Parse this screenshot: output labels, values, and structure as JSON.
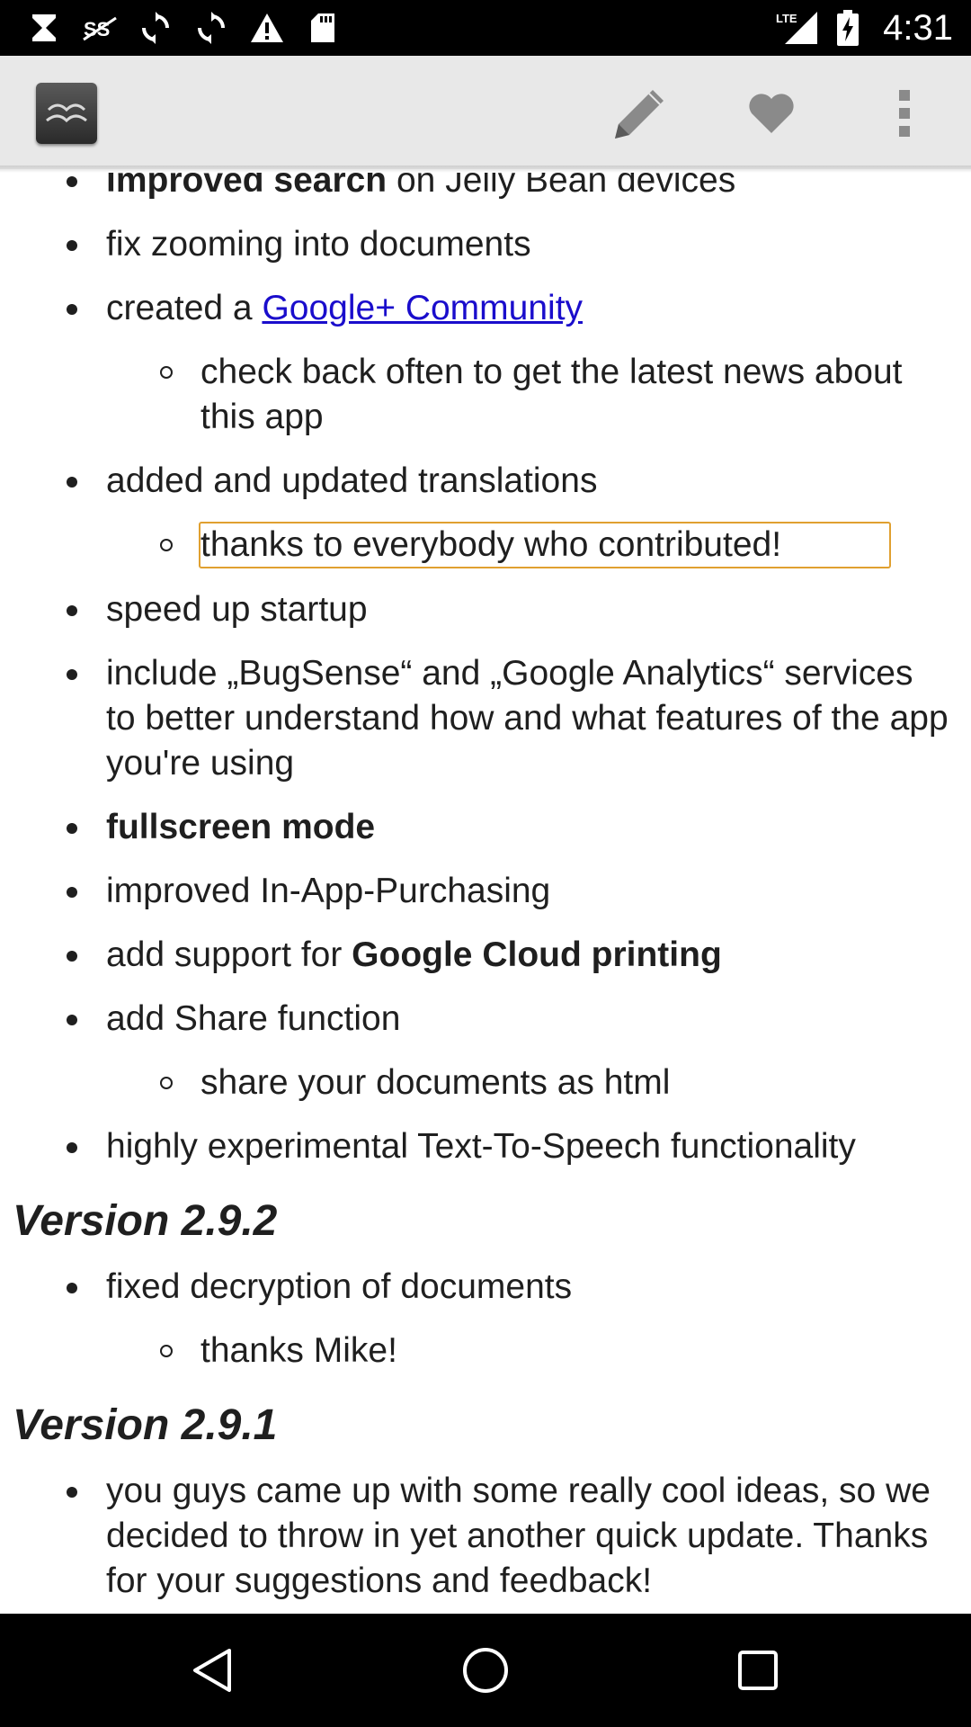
{
  "status_bar": {
    "time": "4:31",
    "network": "LTE",
    "left_icons": [
      "hourglass-icon",
      "sync-disabled-icon",
      "sync-icon",
      "sync-icon",
      "warning-icon",
      "sd-card-icon"
    ],
    "right_icons": [
      "signal-icon",
      "battery-charging-icon"
    ]
  },
  "action_bar": {
    "app_icon": "app-logo-icon",
    "actions": [
      "pencil-icon",
      "heart-icon",
      "overflow-menu-icon"
    ],
    "colors": {
      "background": "#e8e8e8"
    }
  },
  "content": {
    "list_a": [
      {
        "bold": "improved search",
        "text": " on Jelly Bean devices"
      },
      {
        "text": "fix zooming into documents"
      },
      {
        "text": "created a ",
        "link": "Google+ Community",
        "sub": [
          "check back often to get the latest news about this app"
        ]
      },
      {
        "text": "added and updated translations",
        "sub": [
          "thanks to everybody who contributed!"
        ]
      },
      {
        "text": "speed up startup"
      },
      {
        "text": "include „BugSense“ and „Google Analytics“ services to better understand how and what features of the app you're using"
      },
      {
        "bold": "fullscreen mode"
      },
      {
        "text": "improved In-App-Purchasing"
      },
      {
        "text": "add support for ",
        "bold": "Google Cloud printing"
      },
      {
        "text": "add Share function",
        "sub": [
          "share your documents as html"
        ]
      },
      {
        "text": "highly experimental Text-To-Speech functionality"
      }
    ],
    "heading_292": "Version 2.9.2",
    "list_b": [
      {
        "text": "fixed decryption of documents",
        "sub": [
          "thanks Mike!"
        ]
      }
    ],
    "heading_291": "Version 2.9.1",
    "list_c": [
      {
        "text": "you guys came up with some really cool ideas, so we decided to throw in yet another quick update. Thanks for your suggestions and feedback!"
      }
    ],
    "colors": {
      "link": "#1a0dcc",
      "focus_border": "#e0a030"
    }
  },
  "nav_bar": {
    "buttons": [
      "back-icon",
      "home-icon",
      "recents-icon"
    ]
  }
}
